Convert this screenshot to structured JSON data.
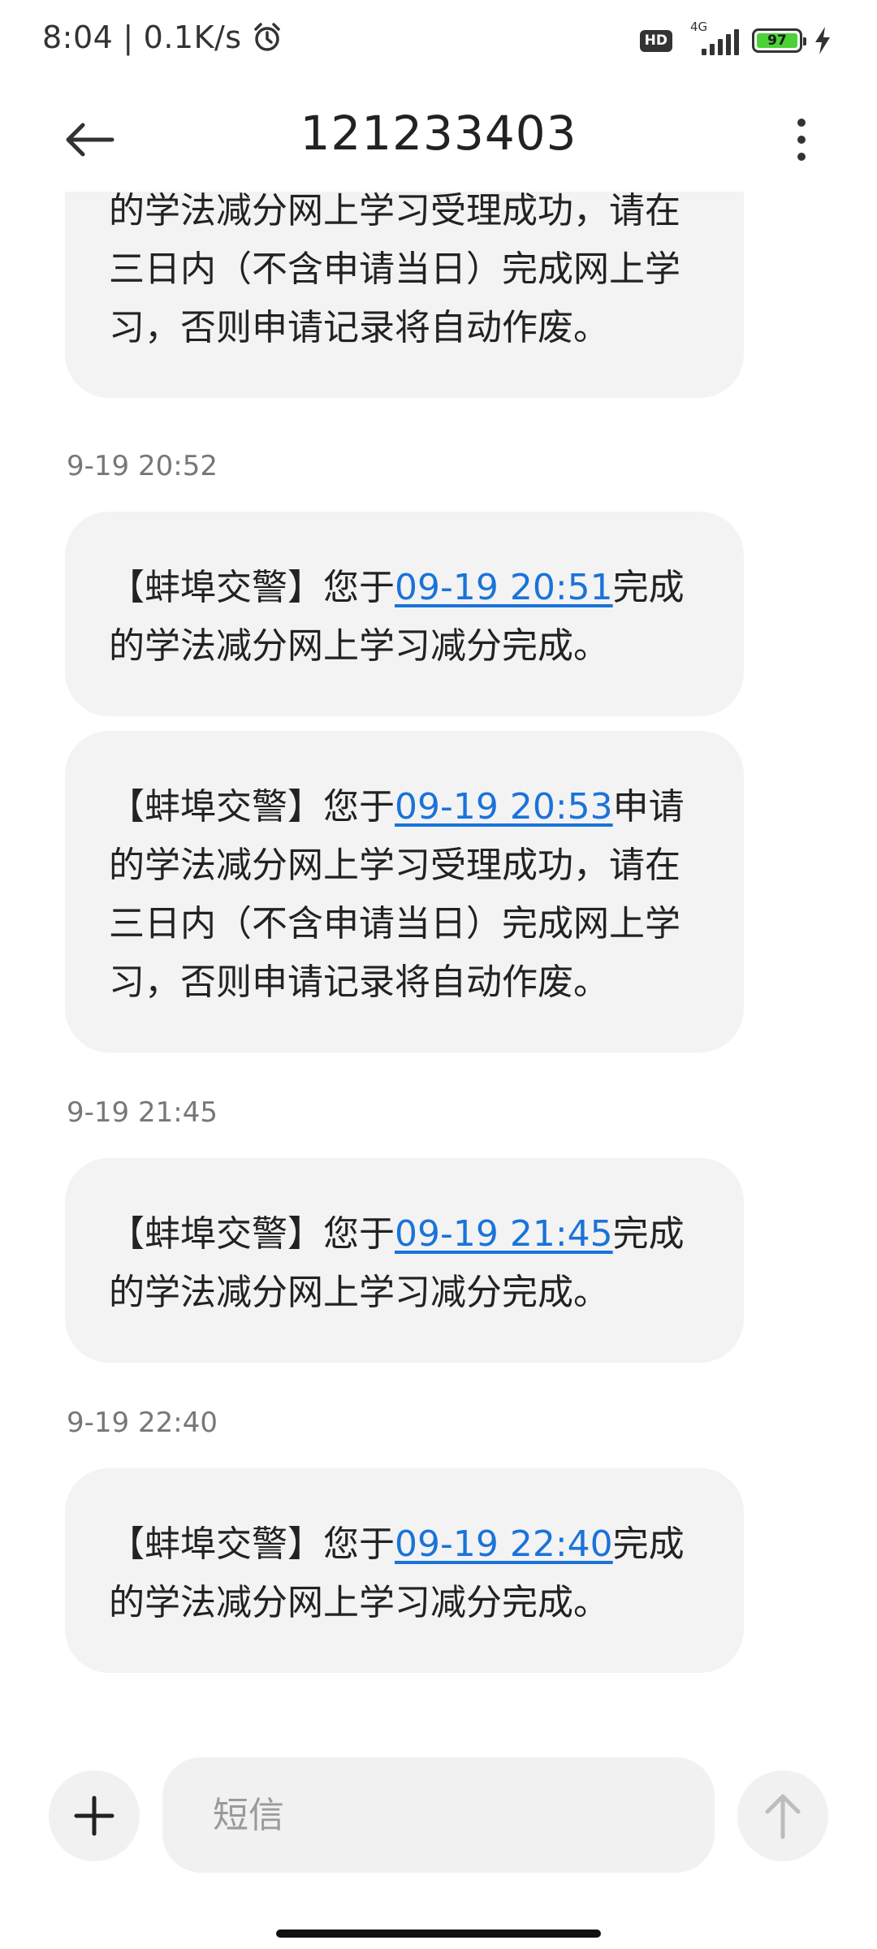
{
  "status_bar": {
    "time": "8:04",
    "separator": "|",
    "net_speed": "0.1K/s",
    "hd_label": "HD",
    "network_label": "4G",
    "battery_level": "97",
    "icons": [
      "alarm-icon",
      "hd-icon",
      "signal-icon",
      "battery-icon",
      "charging-bolt-icon"
    ]
  },
  "header": {
    "title": "121233403",
    "back_icon": "arrow-left-icon",
    "menu_icon": "more-vertical-icon"
  },
  "messages": [
    {
      "lines": [
        "的学法减分网上学习受理成功，请在",
        "三日内（不含申请当日）完成网上学",
        "习，否则申请记录将自动作废。"
      ]
    },
    {
      "time": "9-19 20:52",
      "prefix": "【蚌埠交警】您于",
      "link": "09-19 20:51",
      "suffix_line1": "完成",
      "lines": [
        "的学法减分网上学习减分完成。"
      ]
    },
    {
      "prefix": "【蚌埠交警】您于",
      "link": "09-19 20:53",
      "suffix_line1": "申请",
      "lines": [
        "的学法减分网上学习受理成功，请在",
        "三日内（不含申请当日）完成网上学",
        "习，否则申请记录将自动作废。"
      ]
    },
    {
      "time": "9-19 21:45",
      "prefix": "【蚌埠交警】您于",
      "link": "09-19 21:45",
      "suffix_line1": "完成",
      "lines": [
        "的学法减分网上学习减分完成。"
      ]
    },
    {
      "time": "9-19 22:40",
      "prefix": "【蚌埠交警】您于",
      "link": "09-19 22:40",
      "suffix_line1": "完成",
      "lines": [
        "的学法减分网上学习减分完成。"
      ]
    }
  ],
  "composer": {
    "placeholder": "短信",
    "add_icon": "plus-icon",
    "send_icon": "arrow-up-icon"
  },
  "colors": {
    "link": "#1a73d9",
    "bubble": "#f3f3f3",
    "battery": "#4cd137"
  }
}
